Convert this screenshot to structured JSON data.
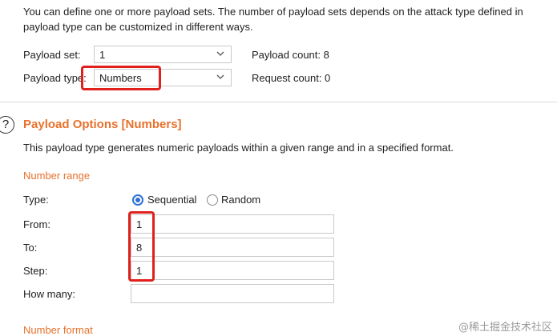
{
  "intro": {
    "line1": "You can define one or more payload sets. The number of payload sets depends on the attack type defined in",
    "line2": "payload type can be customized in different ways."
  },
  "payload_set": {
    "label": "Payload set:",
    "value": "1"
  },
  "payload_type": {
    "label": "Payload type:",
    "value": "Numbers"
  },
  "payload_count": "Payload count: 8",
  "request_count": "Request count: 0",
  "options": {
    "help_glyph": "?",
    "title": "Payload Options [Numbers]",
    "description": "This payload type generates numeric payloads within a given range and in a specified format."
  },
  "number_range": {
    "heading": "Number range",
    "type_label": "Type:",
    "radio_sequential": "Sequential",
    "radio_random": "Random",
    "selected": "Sequential",
    "from_label": "From:",
    "from_value": "1",
    "to_label": "To:",
    "to_value": "8",
    "step_label": "Step:",
    "step_value": "1",
    "how_many_label": "How many:",
    "how_many_value": ""
  },
  "number_format": {
    "heading": "Number format"
  },
  "watermark": "@稀土掘金技术社区",
  "colors": {
    "accent": "#e8712c",
    "highlight": "#e0201b",
    "radio": "#2d6fd3"
  }
}
